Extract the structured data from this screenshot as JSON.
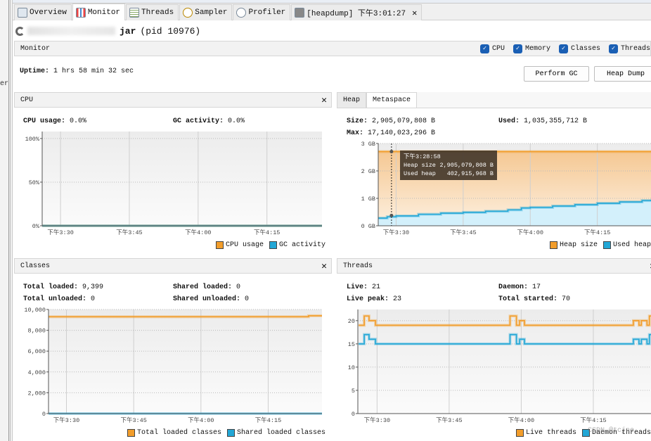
{
  "sidebar_fragment": "er",
  "tabs": [
    {
      "label": "Overview",
      "icon": "overview-icon",
      "active": false
    },
    {
      "label": "Monitor",
      "icon": "monitor-icon",
      "active": true
    },
    {
      "label": "Threads",
      "icon": "threads-icon",
      "active": false
    },
    {
      "label": "Sampler",
      "icon": "sampler-icon",
      "active": false
    },
    {
      "label": "Profiler",
      "icon": "profiler-icon",
      "active": false
    },
    {
      "label": "[heapdump] 下午3:01:27",
      "icon": "heapdump-icon",
      "active": false,
      "closable": true
    }
  ],
  "app": {
    "name_suffix": "jar",
    "pid": "(pid 10976)"
  },
  "monitor": {
    "header": "Monitor",
    "checkboxes": [
      {
        "label": "CPU",
        "checked": true
      },
      {
        "label": "Memory",
        "checked": true
      },
      {
        "label": "Classes",
        "checked": true
      },
      {
        "label": "Threads",
        "checked": true
      }
    ],
    "uptime_label": "Uptime:",
    "uptime_value": "1 hrs 58 min 32 sec",
    "perform_gc": "Perform GC",
    "heap_dump": "Heap Dump"
  },
  "cpu": {
    "title": "CPU",
    "stats": [
      {
        "label": "CPU usage:",
        "value": "0.0%"
      },
      {
        "label": "GC activity:",
        "value": "0.0%"
      }
    ]
  },
  "memory": {
    "tabs": [
      "Heap",
      "Metaspace"
    ],
    "active_tab": "Heap",
    "stats": [
      {
        "label": "Size:",
        "value": "2,905,079,808 B"
      },
      {
        "label": "Used:",
        "value": "1,035,355,712 B"
      },
      {
        "label": "Max:",
        "value": "17,140,023,296 B"
      }
    ],
    "tooltip": {
      "time": "下午3:28:58",
      "rows": [
        {
          "label": "Heap size",
          "value": "2,905,079,808 B"
        },
        {
          "label": "Used heap",
          "value": "402,915,968 B"
        }
      ]
    }
  },
  "classes": {
    "title": "Classes",
    "stats": [
      {
        "label": "Total loaded:",
        "value": "9,399"
      },
      {
        "label": "Shared loaded:",
        "value": "0"
      },
      {
        "label": "Total unloaded:",
        "value": "0"
      },
      {
        "label": "Shared unloaded:",
        "value": "0"
      }
    ]
  },
  "threads": {
    "title": "Threads",
    "stats": [
      {
        "label": "Live:",
        "value": "21"
      },
      {
        "label": "Daemon:",
        "value": "17"
      },
      {
        "label": "Live peak:",
        "value": "23"
      },
      {
        "label": "Total started:",
        "value": "70"
      }
    ]
  },
  "watermark": "CSDN @tcjne",
  "colors": {
    "orange": "#f29d2b",
    "blue": "#22a7d6",
    "accent": "#1a5fb4"
  },
  "chart_data": [
    {
      "type": "line",
      "xlim": [
        "15:26",
        "16:27"
      ],
      "ylim": [
        0,
        108
      ],
      "x_ticks": [
        {
          "t": "15:30",
          "label": "下午3:30"
        },
        {
          "t": "15:45",
          "label": "下午3:45"
        },
        {
          "t": "16:00",
          "label": "下午4:00"
        },
        {
          "t": "16:15",
          "label": "下午4:15"
        }
      ],
      "y_ticks": [
        {
          "v": 0,
          "label": "0%"
        },
        {
          "v": 50,
          "label": "50%"
        },
        {
          "v": 100,
          "label": "100%"
        }
      ],
      "grid": true,
      "legend": "bottom-right",
      "series": [
        {
          "name": "CPU usage",
          "color": "#f29d2b",
          "points": [
            [
              "15:26",
              0
            ],
            [
              "16:27",
              0
            ]
          ]
        },
        {
          "name": "GC activity",
          "color": "#22a7d6",
          "points": [
            [
              "15:26",
              0
            ],
            [
              "16:27",
              0
            ]
          ]
        }
      ]
    },
    {
      "type": "area",
      "xlim": [
        "15:26",
        "16:27"
      ],
      "ylim": [
        0,
        3
      ],
      "x_ticks": [
        {
          "t": "15:30",
          "label": "下午3:30"
        },
        {
          "t": "15:45",
          "label": "下午3:45"
        },
        {
          "t": "16:00",
          "label": "下午4:00"
        },
        {
          "t": "16:15",
          "label": "下午4:15"
        }
      ],
      "y_ticks": [
        {
          "v": 0,
          "label": "0 GB"
        },
        {
          "v": 1,
          "label": "1 GB"
        },
        {
          "v": 2,
          "label": "2 GB"
        },
        {
          "v": 3,
          "label": "3 GB"
        }
      ],
      "grid": true,
      "legend": "bottom-right",
      "series": [
        {
          "name": "Heap size",
          "color": "#f29d2b",
          "points": [
            [
              "15:26",
              2.706
            ],
            [
              "16:27",
              2.706
            ]
          ]
        },
        {
          "name": "Used heap",
          "color": "#22a7d6",
          "points": [
            [
              "15:26",
              0.28
            ],
            [
              "15:28",
              0.33
            ],
            [
              "15:30",
              0.36
            ],
            [
              "15:35",
              0.42
            ],
            [
              "15:40",
              0.46
            ],
            [
              "15:45",
              0.49
            ],
            [
              "15:50",
              0.53
            ],
            [
              "15:55",
              0.58
            ],
            [
              "15:58",
              0.65
            ],
            [
              "16:00",
              0.67
            ],
            [
              "16:05",
              0.72
            ],
            [
              "16:10",
              0.77
            ],
            [
              "16:15",
              0.82
            ],
            [
              "16:20",
              0.87
            ],
            [
              "16:25",
              0.92
            ],
            [
              "16:27",
              0.95
            ]
          ]
        }
      ]
    },
    {
      "type": "line",
      "xlim": [
        "15:26",
        "16:27"
      ],
      "ylim": [
        0,
        10000
      ],
      "x_ticks": [
        {
          "t": "15:30",
          "label": "下午3:30"
        },
        {
          "t": "15:45",
          "label": "下午3:45"
        },
        {
          "t": "16:00",
          "label": "下午4:00"
        },
        {
          "t": "16:15",
          "label": "下午4:15"
        }
      ],
      "y_ticks": [
        {
          "v": 0,
          "label": "0"
        },
        {
          "v": 2000,
          "label": "2,000"
        },
        {
          "v": 4000,
          "label": "4,000"
        },
        {
          "v": 6000,
          "label": "6,000"
        },
        {
          "v": 8000,
          "label": "8,000"
        },
        {
          "v": 10000,
          "label": "10,000"
        }
      ],
      "grid": true,
      "legend": "bottom-right",
      "series": [
        {
          "name": "Total loaded classes",
          "color": "#f29d2b",
          "points": [
            [
              "15:26",
              9300
            ],
            [
              "16:24",
              9399
            ],
            [
              "16:27",
              9399
            ]
          ]
        },
        {
          "name": "Shared loaded classes",
          "color": "#22a7d6",
          "points": [
            [
              "15:26",
              0
            ],
            [
              "16:27",
              0
            ]
          ]
        }
      ]
    },
    {
      "type": "line",
      "xlim": [
        "15:26",
        "16:27"
      ],
      "ylim": [
        0,
        22.4
      ],
      "x_ticks": [
        {
          "t": "15:30",
          "label": "下午3:30"
        },
        {
          "t": "15:45",
          "label": "下午3:45"
        },
        {
          "t": "16:00",
          "label": "下午4:00"
        },
        {
          "t": "16:15",
          "label": "下午4:15"
        }
      ],
      "y_ticks": [
        {
          "v": 0,
          "label": "0"
        },
        {
          "v": 5,
          "label": "5"
        },
        {
          "v": 10,
          "label": "10"
        },
        {
          "v": 15,
          "label": "15"
        },
        {
          "v": 20,
          "label": "20"
        }
      ],
      "grid": true,
      "legend": "bottom-right",
      "series": [
        {
          "name": "Live threads",
          "color": "#f29d2b",
          "points": [
            [
              "15:26:10",
              19
            ],
            [
              "15:27:20",
              21
            ],
            [
              "15:28:20",
              20
            ],
            [
              "15:29:40",
              19
            ],
            [
              "15:57:40",
              21
            ],
            [
              "15:59:00",
              19
            ],
            [
              "15:59:40",
              20
            ],
            [
              "16:00:40",
              19
            ],
            [
              "16:23:20",
              20
            ],
            [
              "16:24:30",
              19
            ],
            [
              "16:25:00",
              20
            ],
            [
              "16:26:10",
              19
            ],
            [
              "16:26:40",
              21
            ],
            [
              "16:27",
              21
            ]
          ]
        },
        {
          "name": "Daemon threads",
          "color": "#22a7d6",
          "points": [
            [
              "15:26:10",
              15
            ],
            [
              "15:27:20",
              17
            ],
            [
              "15:28:20",
              16
            ],
            [
              "15:29:40",
              15
            ],
            [
              "15:57:40",
              17
            ],
            [
              "15:59:00",
              15
            ],
            [
              "15:59:40",
              16
            ],
            [
              "16:00:40",
              15
            ],
            [
              "16:23:20",
              16
            ],
            [
              "16:24:30",
              15
            ],
            [
              "16:25:00",
              16
            ],
            [
              "16:26:10",
              15
            ],
            [
              "16:26:40",
              17
            ],
            [
              "16:27",
              17
            ]
          ]
        }
      ]
    }
  ]
}
